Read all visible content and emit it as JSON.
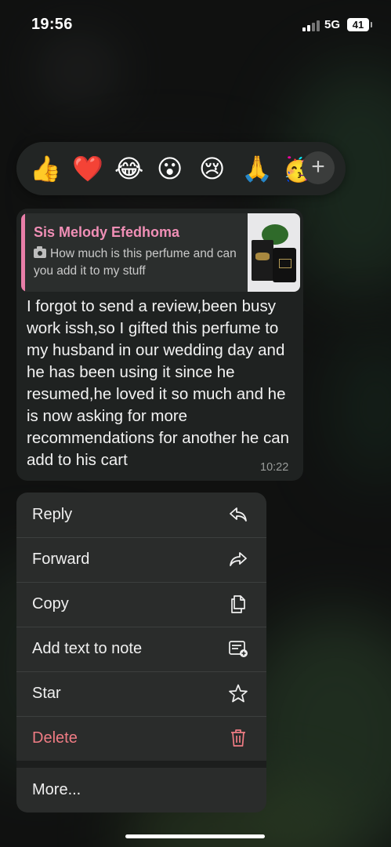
{
  "status_bar": {
    "time": "19:56",
    "network": "5G",
    "battery": "41"
  },
  "reactions": {
    "emojis": [
      "👍",
      "❤️",
      "😂",
      "😮",
      "😢",
      "🙏",
      "🥳"
    ],
    "emoji_names": [
      "thumbs-up",
      "red-heart",
      "tears-of-joy",
      "surprised",
      "crying",
      "folded-hands",
      "party-face"
    ],
    "add_label": "+"
  },
  "message": {
    "quoted": {
      "sender": "Sis Melody Efedhoma",
      "text": "How much is this perfume and can you add it to my stuff",
      "has_photo": true
    },
    "text": "I forgot to send a review,been busy work issh,so I gifted this perfume to my husband in our wedding day and he has been using it since he resumed,he loved it so much and he is now asking for more recommendations for another he can add to his cart",
    "time": "10:22"
  },
  "menu": {
    "items": [
      {
        "label": "Reply",
        "icon": "reply-icon"
      },
      {
        "label": "Forward",
        "icon": "forward-icon"
      },
      {
        "label": "Copy",
        "icon": "copy-icon"
      },
      {
        "label": "Add text to note",
        "icon": "note-add-icon"
      },
      {
        "label": "Star",
        "icon": "star-icon"
      },
      {
        "label": "Delete",
        "icon": "trash-icon"
      }
    ],
    "more_label": "More...",
    "delete_color": "#f07c84",
    "accent_quote_color": "#f08fb6"
  }
}
